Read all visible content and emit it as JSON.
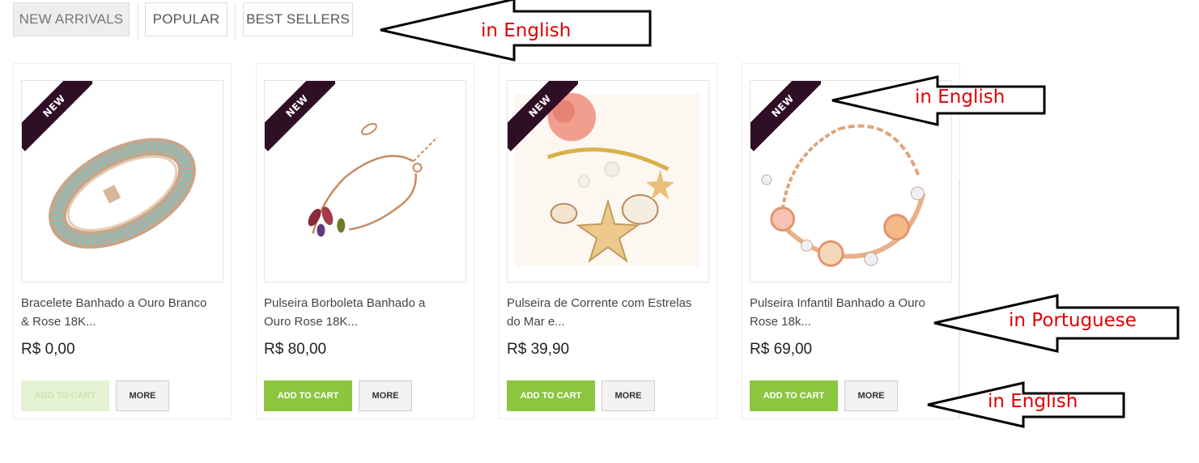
{
  "tabs": [
    {
      "label": "NEW ARRIVALS",
      "active": true
    },
    {
      "label": "POPULAR",
      "active": false
    },
    {
      "label": "BEST SELLERS",
      "active": false
    }
  ],
  "ribbon_label": "NEW",
  "products": [
    {
      "title": "Bracelete Banhado a Ouro Branco & Rose 18K...",
      "price": "R$ 0,00",
      "cart_label": "ADD TO CART",
      "cart_enabled": false,
      "more_label": "MORE"
    },
    {
      "title": "Pulseira Borboleta Banhado a Ouro Rose 18K...",
      "price": "R$ 80,00",
      "cart_label": "ADD TO CART",
      "cart_enabled": true,
      "more_label": "MORE"
    },
    {
      "title": "Pulseira de Corrente com Estrelas do Mar e...",
      "price": "R$ 39,90",
      "cart_label": "ADD TO CART",
      "cart_enabled": true,
      "more_label": "MORE"
    },
    {
      "title": "Pulseira Infantil Banhado a Ouro Rose 18k...",
      "price": "R$ 69,00",
      "cart_label": "ADD TO CART",
      "cart_enabled": true,
      "more_label": "MORE"
    }
  ],
  "annotations": [
    {
      "text": "in English"
    },
    {
      "text": "in English"
    },
    {
      "text": "in Portuguese"
    },
    {
      "text": "in English"
    }
  ],
  "colors": {
    "cart_button": "#8cc63f",
    "ribbon": "#2f0f25",
    "annotation_text": "#e00000"
  }
}
